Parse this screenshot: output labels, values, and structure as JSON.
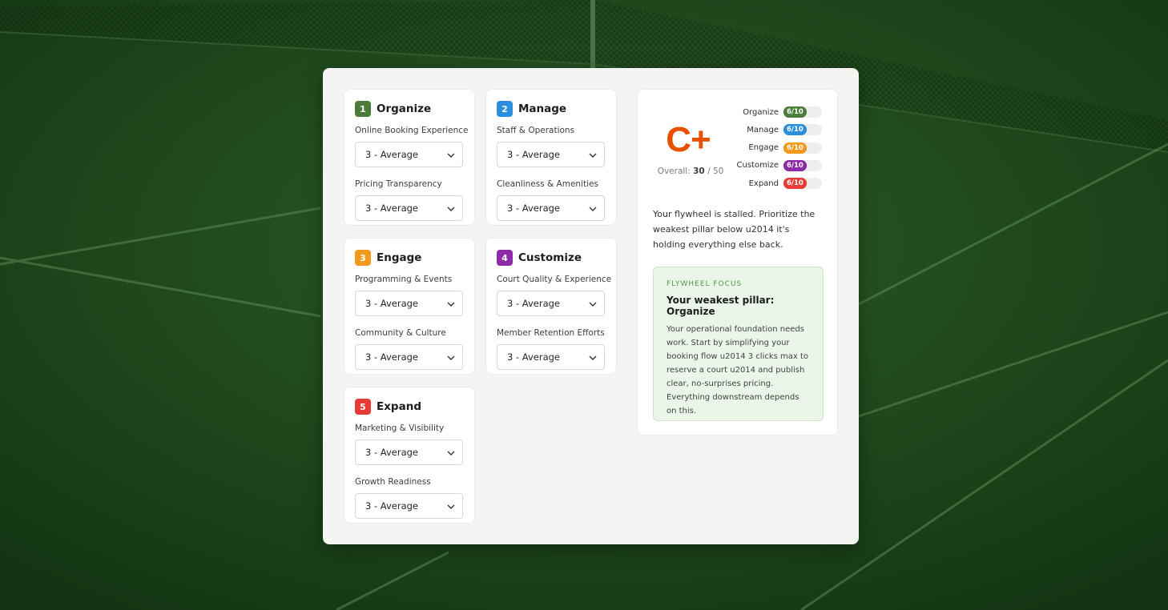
{
  "colors": {
    "organize": "#4b7d3a",
    "manage": "#2b8fde",
    "engage": "#f39a1c",
    "customize": "#8e2aa8",
    "expand": "#e63c35",
    "grade": "#e65100"
  },
  "pillars": [
    {
      "num": "1",
      "title": "Organize",
      "color": "organize",
      "questions": [
        {
          "label": "Online Booking Experience",
          "value": "3 - Average"
        },
        {
          "label": "Pricing Transparency",
          "value": "3 - Average"
        }
      ]
    },
    {
      "num": "2",
      "title": "Manage",
      "color": "manage",
      "questions": [
        {
          "label": "Staff & Operations",
          "value": "3 - Average"
        },
        {
          "label": "Cleanliness & Amenities",
          "value": "3 - Average"
        }
      ]
    },
    {
      "num": "3",
      "title": "Engage",
      "color": "engage",
      "questions": [
        {
          "label": "Programming & Events",
          "value": "3 - Average"
        },
        {
          "label": "Community & Culture",
          "value": "3 - Average"
        }
      ]
    },
    {
      "num": "4",
      "title": "Customize",
      "color": "customize",
      "questions": [
        {
          "label": "Court Quality & Experience",
          "value": "3 - Average"
        },
        {
          "label": "Member Retention Efforts",
          "value": "3 - Average"
        }
      ]
    },
    {
      "num": "5",
      "title": "Expand",
      "color": "expand",
      "questions": [
        {
          "label": "Marketing & Visibility",
          "value": "3 - Average"
        },
        {
          "label": "Growth Readiness",
          "value": "3 - Average"
        }
      ]
    }
  ],
  "results": {
    "grade": "C+",
    "overall_label": "Overall:",
    "overall_score": "30",
    "overall_max": "/ 50",
    "scores": [
      {
        "name": "Organize",
        "value": "6/10",
        "fraction": 0.6,
        "color": "organize"
      },
      {
        "name": "Manage",
        "value": "6/10",
        "fraction": 0.6,
        "color": "manage"
      },
      {
        "name": "Engage",
        "value": "6/10",
        "fraction": 0.6,
        "color": "engage"
      },
      {
        "name": "Customize",
        "value": "6/10",
        "fraction": 0.6,
        "color": "customize"
      },
      {
        "name": "Expand",
        "value": "6/10",
        "fraction": 0.6,
        "color": "expand"
      }
    ],
    "message": "Your flywheel is stalled. Prioritize the weakest pillar below u2014 it's holding everything else back.",
    "focus": {
      "kicker": "FLYWHEEL FOCUS",
      "title": "Your weakest pillar: Organize",
      "body": "Your operational foundation needs work. Start by simplifying your booking flow u2014 3 clicks max to reserve a court u2014 and publish clear, no-surprises pricing. Everything downstream depends on this."
    }
  }
}
